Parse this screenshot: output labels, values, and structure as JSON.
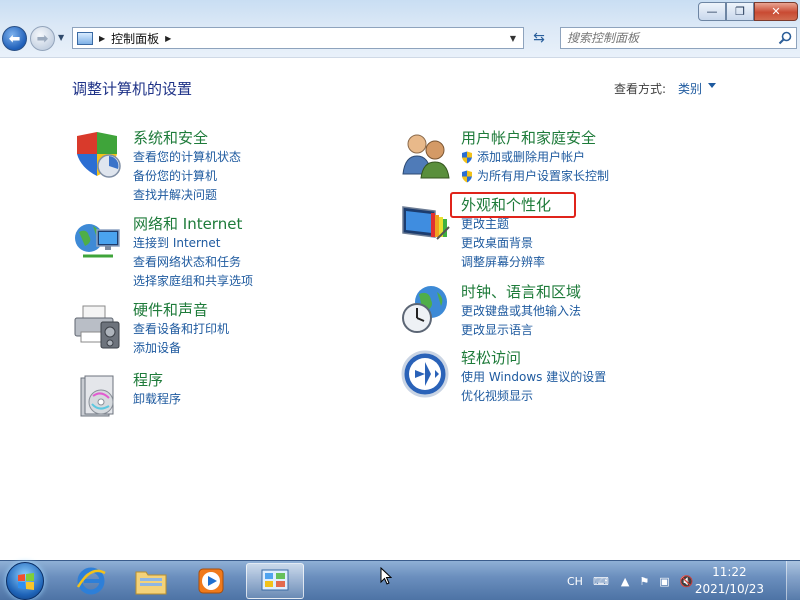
{
  "window": {
    "minimize": "—",
    "maximize": "❐",
    "close": "✕"
  },
  "nav": {
    "address": "控制面板",
    "search_placeholder": "搜索控制面板"
  },
  "page": {
    "title": "调整计算机的设置",
    "view_label": "查看方式:",
    "view_value": "类别"
  },
  "categories_left": [
    {
      "title": "系统和安全",
      "icon": "shield-icon",
      "links": [
        "查看您的计算机状态",
        "备份您的计算机",
        "查找并解决问题"
      ]
    },
    {
      "title": "网络和 Internet",
      "icon": "network-globe-icon",
      "links": [
        "连接到 Internet",
        "查看网络状态和任务",
        "选择家庭组和共享选项"
      ]
    },
    {
      "title": "硬件和声音",
      "icon": "printer-icon",
      "links": [
        "查看设备和打印机",
        "添加设备"
      ]
    },
    {
      "title": "程序",
      "icon": "programs-icon",
      "links": [
        "卸载程序"
      ]
    }
  ],
  "categories_right": [
    {
      "title": "用户帐户和家庭安全",
      "icon": "users-icon",
      "links": [
        "添加或删除用户帐户",
        "为所有用户设置家长控制"
      ]
    },
    {
      "title": "外观和个性化",
      "icon": "monitor-paint-icon",
      "links": [
        "更改主题",
        "更改桌面背景",
        "调整屏幕分辨率"
      ]
    },
    {
      "title": "时钟、语言和区域",
      "icon": "clock-globe-icon",
      "links": [
        "更改键盘或其他输入法",
        "更改显示语言"
      ]
    },
    {
      "title": "轻松访问",
      "icon": "accessibility-icon",
      "links": [
        "使用 Windows 建议的设置",
        "优化视频显示"
      ]
    }
  ],
  "taskbar": {
    "language": "CH",
    "time": "11:22",
    "date": "2021/10/23"
  },
  "colors": {
    "category_title": "#1e7b3a",
    "link": "#1e5a9f",
    "page_title": "#1e3287",
    "highlight": "#e0241b"
  }
}
